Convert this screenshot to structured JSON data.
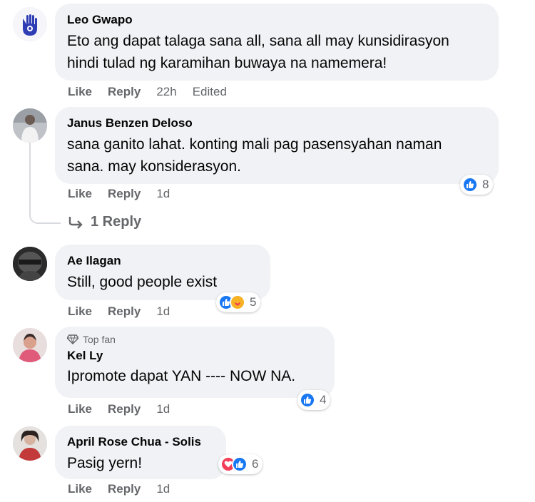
{
  "comments": [
    {
      "author": "Leo Gwapo",
      "text_line1": "Eto ang dapat talaga sana all, sana all may kunsidirasyon",
      "text_line2": "hindi tulad ng karamihan buwaya na namemera!",
      "like": "Like",
      "reply": "Reply",
      "time": "22h",
      "edited": "Edited"
    },
    {
      "author": "Janus Benzen Deloso",
      "text_line1": "sana ganito lahat. konting mali pag pasensyahan naman",
      "text_line2": "sana. may konsiderasyon.",
      "like": "Like",
      "reply": "Reply",
      "time": "1d",
      "reaction_count": "8",
      "replies_label": "1 Reply"
    },
    {
      "author": "Ae Ilagan",
      "text_line1": "Still, good people exist",
      "like": "Like",
      "reply": "Reply",
      "time": "1d",
      "reaction_count": "5"
    },
    {
      "badge": "Top fan",
      "author": "Kel Ly",
      "text_line1": "Ipromote dapat YAN ---- NOW NA.",
      "like": "Like",
      "reply": "Reply",
      "time": "1d",
      "reaction_count": "4"
    },
    {
      "author": "April Rose Chua - Solis",
      "text_line1": "Pasig yern!",
      "like": "Like",
      "reply": "Reply",
      "time": "1d",
      "reaction_count": "6"
    }
  ],
  "colors": {
    "bubble": "#f0f2f5",
    "like_blue": "#1877f2",
    "love_red": "#f33e58",
    "meta_gray": "#65676b"
  }
}
